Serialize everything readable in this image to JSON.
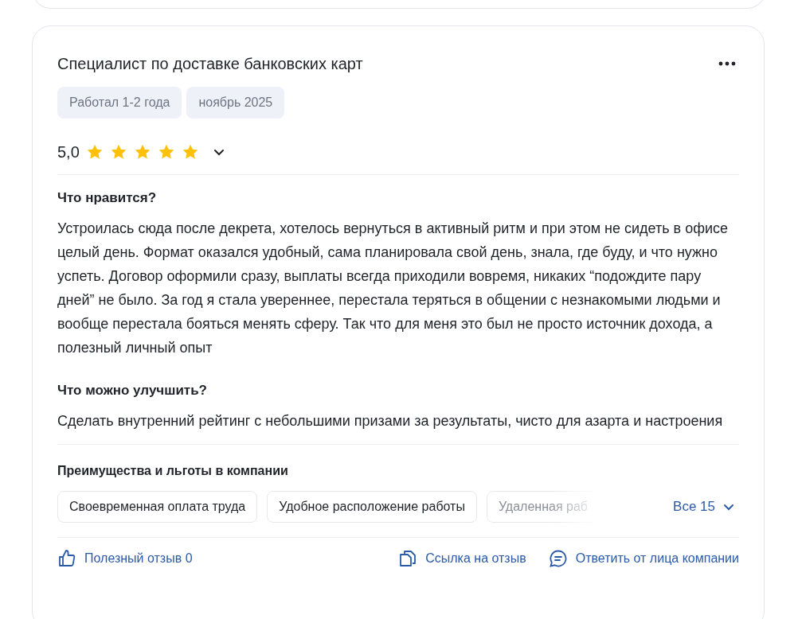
{
  "review": {
    "title": "Специалист по доставке банковских карт",
    "tags": [
      "Работал 1-2 года",
      "ноябрь 2025"
    ],
    "rating": "5,0",
    "stars": 5,
    "sections": [
      {
        "heading": "Что нравится?",
        "text": "Устроилась сюда после декрета, хотелось вернуться в активный ритм и при этом не сидеть в офисе целый день. Формат оказался удобный, сама планировала свой день, знала, где буду, и что нужно успеть. Договор оформили сразу, выплаты всегда приходили вовремя, никаких “подождите пару дней” не было. За год я стала увереннее, перестала теряться в общении с незнакомыми людьми и вообще перестала бояться менять сферу. Так что для меня это был не просто источник дохода, а полезный личный опыт"
      },
      {
        "heading": "Что можно улучшить?",
        "text": "Сделать внутренний рейтинг с небольшими призами за результаты, чисто для азарта и настроения"
      }
    ],
    "benefits": {
      "heading": "Преимущества и льготы в компании",
      "items": [
        "Своевременная оплата труда",
        "Удобное расположение работы",
        "Удаленная раб"
      ],
      "more": "Все 15"
    },
    "actions": [
      {
        "kind": "like",
        "label": "Полезный отзыв 0"
      },
      {
        "kind": "link",
        "label": "Ссылка на отзыв"
      },
      {
        "kind": "reply",
        "label": "Ответить от лица компании"
      }
    ]
  }
}
